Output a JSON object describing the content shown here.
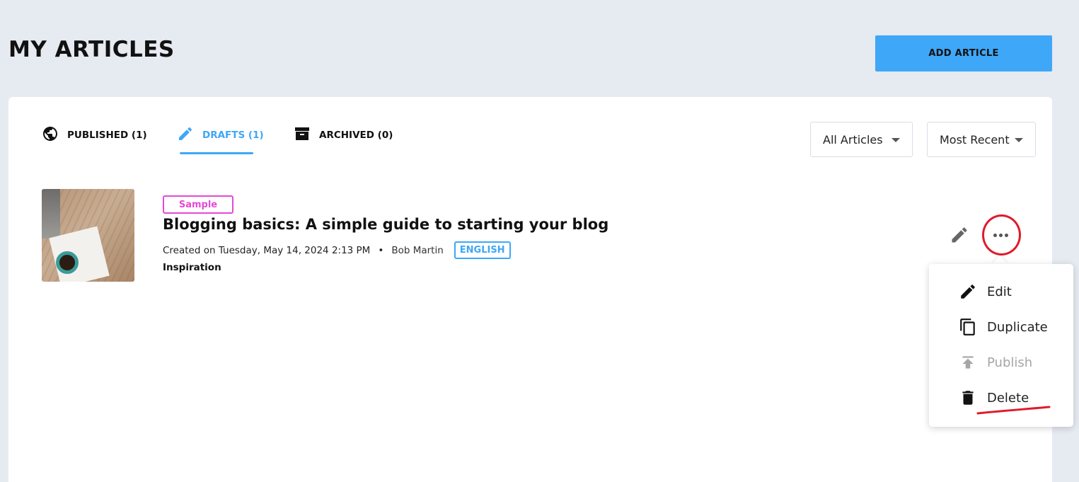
{
  "page": {
    "title": "MY ARTICLES"
  },
  "header": {
    "add_article_label": "ADD ARTICLE"
  },
  "tabs": [
    {
      "label": "PUBLISHED (1)",
      "icon": "globe-icon",
      "active": false
    },
    {
      "label": "DRAFTS (1)",
      "icon": "pencil-icon",
      "active": true
    },
    {
      "label": "ARCHIVED (0)",
      "icon": "archive-box-icon",
      "active": false
    }
  ],
  "filters": {
    "filter_value": "All Articles",
    "sort_value": "Most Recent"
  },
  "article": {
    "badge": "Sample",
    "title": "Blogging basics: A simple guide to starting your blog",
    "created": "Created on Tuesday, May 14, 2024 2:13 PM",
    "separator": "•",
    "author": "Bob Martin",
    "language": "ENGLISH",
    "category": "Inspiration"
  },
  "actions_menu": {
    "items": [
      {
        "label": "Edit",
        "icon": "pencil-icon",
        "enabled": true
      },
      {
        "label": "Duplicate",
        "icon": "copy-icon",
        "enabled": true
      },
      {
        "label": "Publish",
        "icon": "publish-arrow-icon",
        "enabled": false
      },
      {
        "label": "Delete",
        "icon": "trash-icon",
        "enabled": true
      }
    ]
  },
  "colors": {
    "accent": "#3ea7f7",
    "sample_badge": "#e649d6",
    "annotation_red": "#e01a2b",
    "background": "#e6eaf1"
  }
}
